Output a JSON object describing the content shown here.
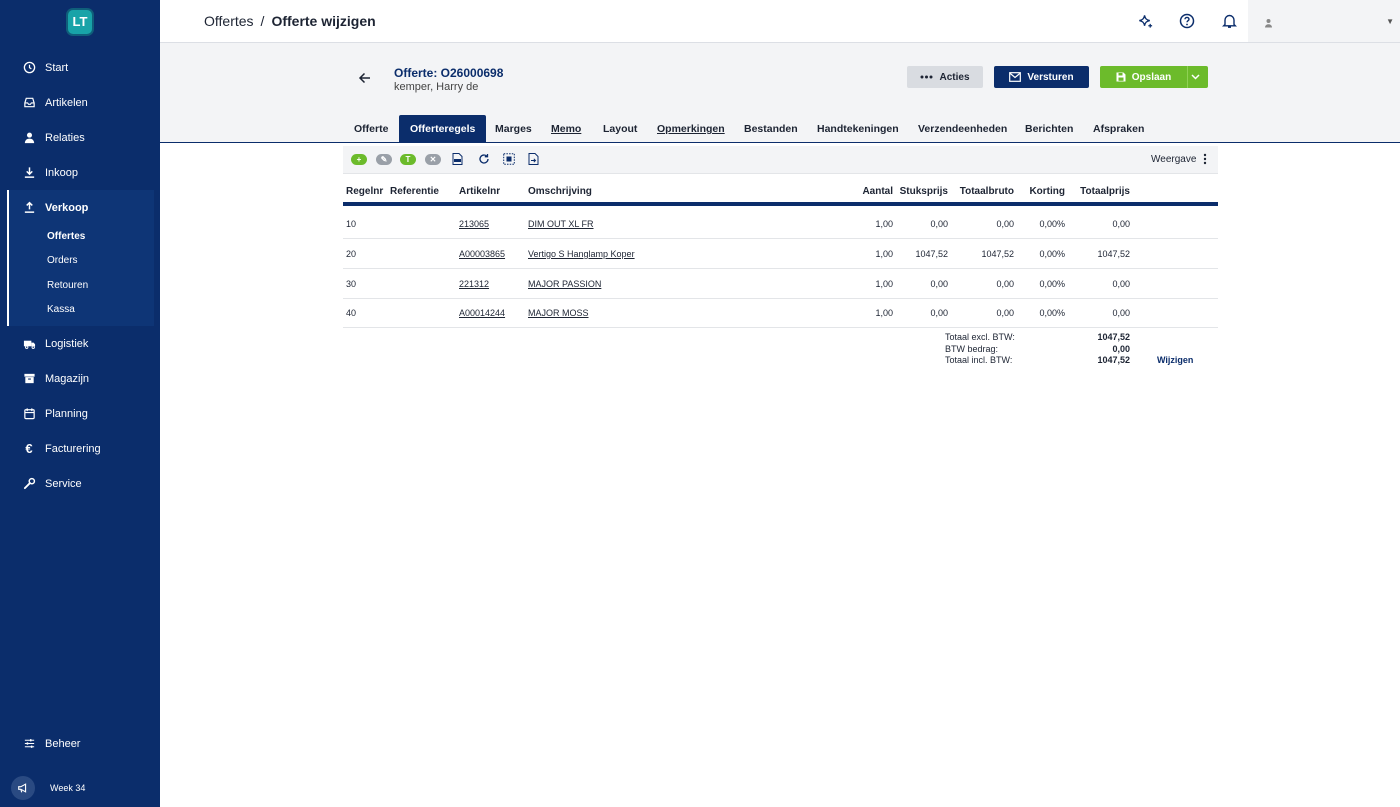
{
  "app": {
    "logo_text": "LT"
  },
  "sidebar": {
    "items": [
      {
        "label": "Start",
        "icon": "clock-icon"
      },
      {
        "label": "Artikelen",
        "icon": "inbox-icon"
      },
      {
        "label": "Relaties",
        "icon": "person-icon"
      },
      {
        "label": "Inkoop",
        "icon": "download-icon"
      },
      {
        "label": "Verkoop",
        "icon": "upload-icon"
      },
      {
        "label": "Logistiek",
        "icon": "truck-icon"
      },
      {
        "label": "Magazijn",
        "icon": "archive-icon"
      },
      {
        "label": "Planning",
        "icon": "calendar-icon"
      },
      {
        "label": "Facturering",
        "icon": "euro-icon"
      },
      {
        "label": "Service",
        "icon": "wrench-icon"
      }
    ],
    "sub_items": [
      "Offertes",
      "Orders",
      "Retouren",
      "Kassa"
    ],
    "beheer": "Beheer",
    "week": "Week 34"
  },
  "topbar": {
    "breadcrumb_parent": "Offertes",
    "breadcrumb_sep": "/",
    "breadcrumb_current": "Offerte wijzigen"
  },
  "header": {
    "title": "Offerte: O26000698",
    "subtitle": "kemper, Harry de",
    "acties": "Acties",
    "versturen": "Versturen",
    "opslaan": "Opslaan"
  },
  "tabs": [
    "Offerte",
    "Offerteregels",
    "Marges",
    "Memo",
    "Layout",
    "Opmerkingen",
    "Bestanden",
    "Handtekeningen",
    "Verzendeenheden",
    "Berichten",
    "Afspraken"
  ],
  "active_tab": "Offerteregels",
  "toolbar": {
    "t_label": "T",
    "weergave": "Weergave"
  },
  "table": {
    "columns": [
      "Regelnr",
      "Referentie",
      "Artikelnr",
      "Omschrijving",
      "Aantal",
      "Stuksprijs",
      "Totaalbruto",
      "Korting",
      "Totaalprijs"
    ],
    "rows": [
      {
        "regelnr": "10",
        "referentie": "",
        "artikelnr": "213065",
        "omschrijving": "DIM OUT XL FR",
        "aantal": "1,00",
        "stuksprijs": "0,00",
        "totaalbruto": "0,00",
        "korting": "0,00%",
        "totaalprijs": "0,00"
      },
      {
        "regelnr": "20",
        "referentie": "",
        "artikelnr": "A00003865",
        "omschrijving": "Vertigo S Hanglamp Koper",
        "aantal": "1,00",
        "stuksprijs": "1047,52",
        "totaalbruto": "1047,52",
        "korting": "0,00%",
        "totaalprijs": "1047,52"
      },
      {
        "regelnr": "30",
        "referentie": "",
        "artikelnr": "221312",
        "omschrijving": "MAJOR PASSION",
        "aantal": "1,00",
        "stuksprijs": "0,00",
        "totaalbruto": "0,00",
        "korting": "0,00%",
        "totaalprijs": "0,00"
      },
      {
        "regelnr": "40",
        "referentie": "",
        "artikelnr": "A00014244",
        "omschrijving": "MAJOR MOSS",
        "aantal": "1,00",
        "stuksprijs": "0,00",
        "totaalbruto": "0,00",
        "korting": "0,00%",
        "totaalprijs": "0,00"
      }
    ]
  },
  "totals": {
    "excl_label": "Totaal excl. BTW:",
    "btw_label": "BTW bedrag:",
    "incl_label": "Totaal incl. BTW:",
    "excl_value": "1047,52",
    "btw_value": "0,00",
    "incl_value": "1047,52",
    "wijzigen": "Wijzigen"
  },
  "colors": {
    "navy": "#0b2d6b",
    "green": "#6cbb2b",
    "teal": "#18a3a8"
  }
}
